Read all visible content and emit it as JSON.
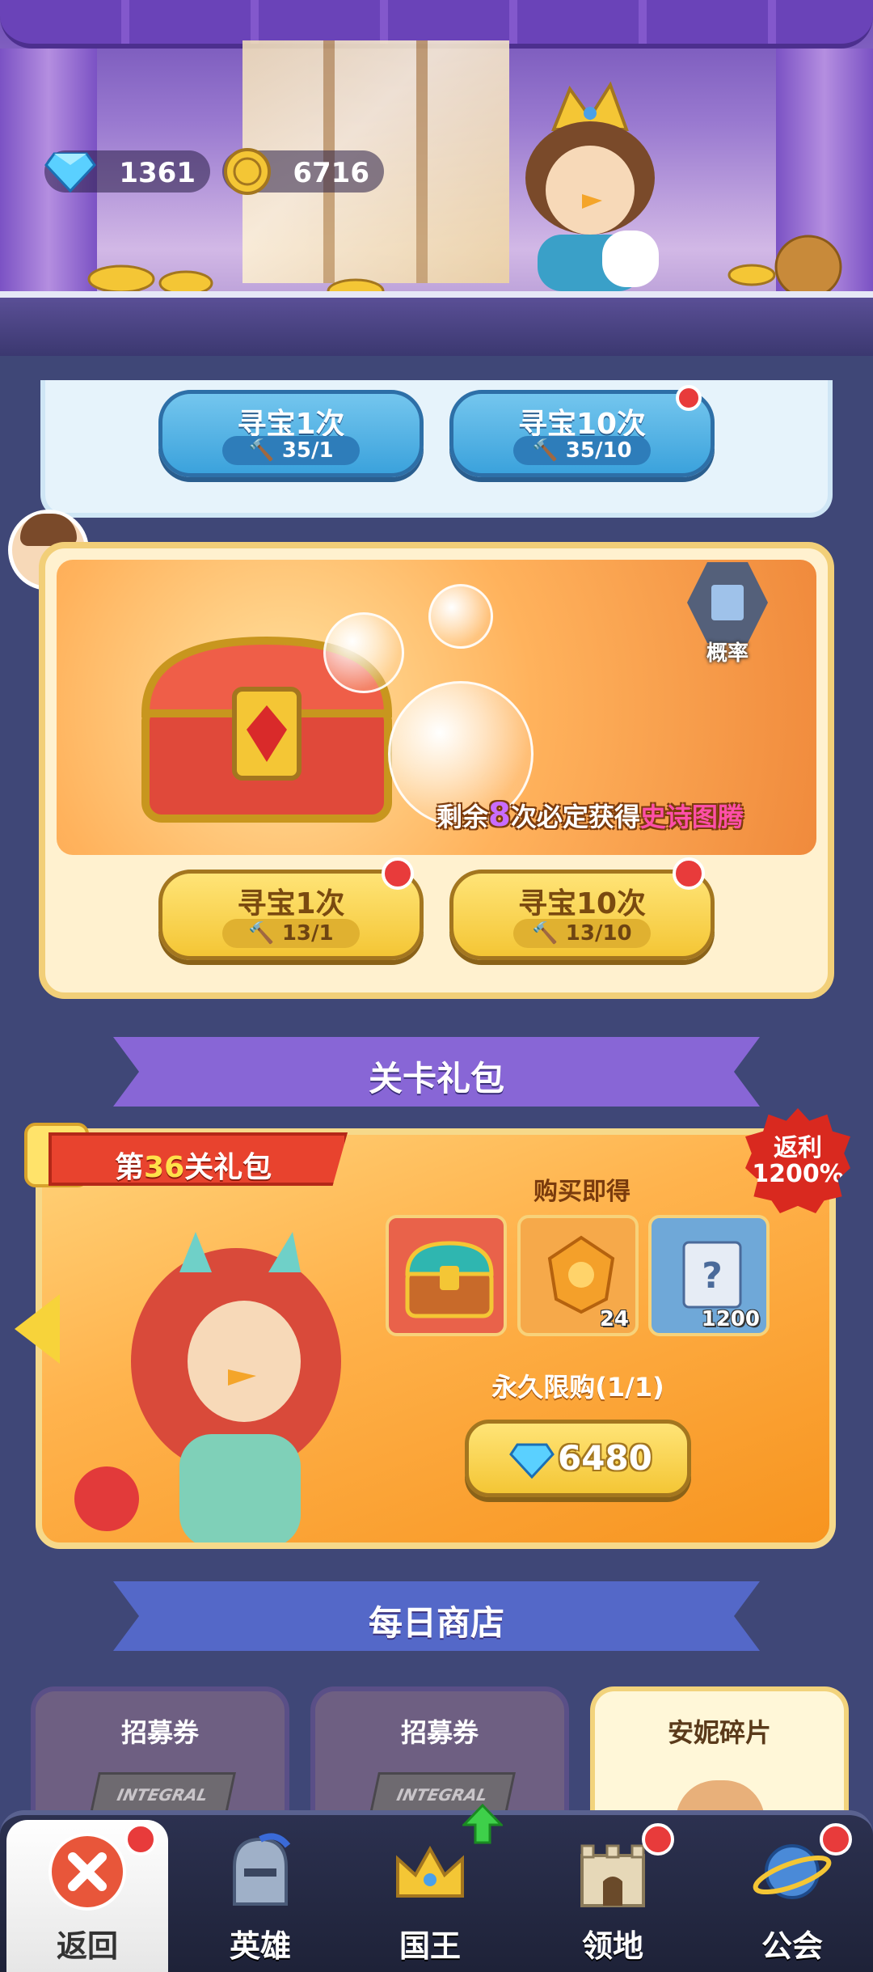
{
  "currency": {
    "diamonds": "1361",
    "coins": "6716"
  },
  "blue_section": {
    "btn1": {
      "label": "寻宝1次",
      "cost": "35/1"
    },
    "btn10": {
      "label": "寻宝10次",
      "cost": "35/10"
    }
  },
  "treasure": {
    "prob_label": "概率",
    "pity": {
      "prefix": "剩余",
      "count": "8",
      "middle": "次必定获得",
      "highlight": "史诗图腾"
    },
    "btn1": {
      "label": "寻宝1次",
      "cost": "13/1"
    },
    "btn10": {
      "label": "寻宝10次",
      "cost": "13/10"
    }
  },
  "level_pack": {
    "section_title": "关卡礼包",
    "tag": {
      "prefix": "第",
      "num": "36",
      "suffix": "关礼包"
    },
    "rebate": {
      "line1": "返利",
      "line2": "1200%"
    },
    "buy_get": "购买即得",
    "items": [
      {
        "name": "treasure-chest",
        "count": ""
      },
      {
        "name": "orange-gem",
        "count": "24"
      },
      {
        "name": "mystery-scroll",
        "count": "1200"
      }
    ],
    "limit": "永久限购(1/1)",
    "price": "6480"
  },
  "daily_shop": {
    "section_title": "每日商店",
    "cards": [
      {
        "title": "招募券",
        "ticket": "INTEGRAL"
      },
      {
        "title": "招募券",
        "ticket": "INTEGRAL"
      },
      {
        "title": "安妮碎片"
      }
    ]
  },
  "nav": {
    "items": [
      {
        "label": "返回",
        "icon": "close-icon"
      },
      {
        "label": "英雄",
        "icon": "helmet-icon"
      },
      {
        "label": "国王",
        "icon": "crown-icon"
      },
      {
        "label": "领地",
        "icon": "castle-icon"
      },
      {
        "label": "公会",
        "icon": "planet-icon"
      }
    ]
  },
  "colors": {
    "background": "#3f4777",
    "accent_yellow": "#f4c635",
    "accent_blue": "#3ba2dc",
    "badge_red": "#e83b3b"
  }
}
